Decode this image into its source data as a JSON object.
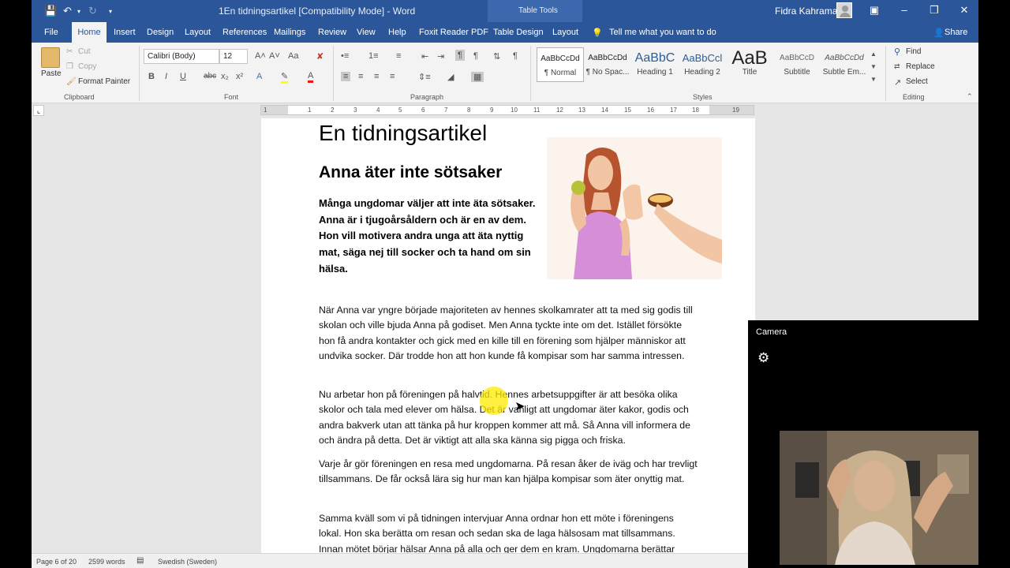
{
  "titlebar": {
    "doc_title": "1En tidningsartikel [Compatibility Mode]  -  Word",
    "context_tab": "Table Tools",
    "user_name": "Fidra Kahraman"
  },
  "tabs": [
    "File",
    "Home",
    "Insert",
    "Design",
    "Layout",
    "References",
    "Mailings",
    "Review",
    "View",
    "Help",
    "Foxit Reader PDF",
    "Table Design",
    "Layout"
  ],
  "tell_me": "Tell me what you want to do",
  "share": "Share",
  "ribbon": {
    "clipboard": {
      "paste": "Paste",
      "cut": "Cut",
      "copy": "Copy",
      "format_painter": "Format Painter",
      "label": "Clipboard"
    },
    "font": {
      "name": "Calibri (Body)",
      "size": "12",
      "label": "Font"
    },
    "paragraph": {
      "label": "Paragraph"
    },
    "styles": {
      "label": "Styles",
      "items": [
        {
          "sample": "AaBbCcDd",
          "name": "¶ Normal"
        },
        {
          "sample": "AaBbCcDd",
          "name": "¶ No Spac..."
        },
        {
          "sample": "AaBbC",
          "name": "Heading 1"
        },
        {
          "sample": "AaBbCcl",
          "name": "Heading 2"
        },
        {
          "sample": "AaB",
          "name": "Title"
        },
        {
          "sample": "AaBbCcD",
          "name": "Subtitle"
        },
        {
          "sample": "AaBbCcDd",
          "name": "Subtle Em..."
        }
      ]
    },
    "editing": {
      "find": "Find",
      "replace": "Replace",
      "select": "Select",
      "label": "Editing"
    }
  },
  "ruler_numbers": [
    "1",
    "1",
    "2",
    "3",
    "4",
    "5",
    "6",
    "7",
    "8",
    "9",
    "10",
    "11",
    "12",
    "13",
    "14",
    "15",
    "16",
    "17",
    "18",
    "19"
  ],
  "document": {
    "title": "En tidningsartikel",
    "headline": "Anna äter inte sötsaker",
    "lead": "Många ungdomar väljer att inte äta sötsaker. Anna är i tjugoårsåldern och är en av dem. Hon vill motivera andra unga att äta nyttig mat, säga nej till socker och ta hand om sin hälsa.",
    "paragraphs": [
      "När Anna var yngre började majoriteten av hennes skolkamrater att ta med sig godis till skolan och ville bjuda Anna på godiset. Men Anna tyckte inte om det. Istället försökte hon få andra kontakter och gick med en kille till en förening som hjälper människor att undvika socker. Där trodde hon att hon kunde få kompisar som har samma intressen.",
      "Nu arbetar hon på föreningen på halvtid. Hennes arbetsuppgifter är att besöka olika skolor och tala med elever om hälsa. Det är vanligt att ungdomar äter kakor, godis och andra bakverk utan att tänka på hur kroppen kommer att må. Så Anna vill informera de och ändra på detta. Det är viktigt att alla ska känna sig pigga och friska.",
      "Varje år gör föreningen en resa med ungdomarna. På resan åker de iväg och har trevligt tillsammans. De får också lära sig hur man kan hjälpa kompisar som äter onyttig mat.",
      "Samma kväll som vi på tidningen intervjuar Anna ordnar hon ett möte i föreningens lokal. Hon ska berätta om resan och sedan ska de laga hälsosam mat tillsammans. Innan mötet börjar hälsar Anna på alla och ger dem en kram. Ungdomarna berättar"
    ]
  },
  "statusbar": {
    "page": "Page 6 of 20",
    "words": "2599 words",
    "language": "Swedish (Sweden)"
  },
  "camera": {
    "title": "Camera"
  }
}
